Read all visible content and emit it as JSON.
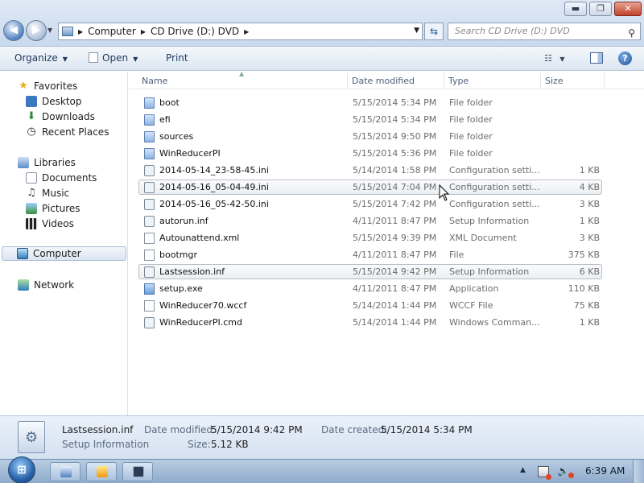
{
  "window": {
    "minimize": "▬",
    "maximize": "❐",
    "close": "✕"
  },
  "address": {
    "crumbs": [
      "Computer",
      "CD Drive (D:) DVD"
    ],
    "search_placeholder": "Search CD Drive (D:) DVD"
  },
  "toolbar": {
    "organize": "Organize",
    "open": "Open",
    "print": "Print",
    "help": "?"
  },
  "nav": {
    "favorites": "Favorites",
    "desktop": "Desktop",
    "downloads": "Downloads",
    "recent_places": "Recent Places",
    "libraries": "Libraries",
    "documents": "Documents",
    "music": "Music",
    "pictures": "Pictures",
    "videos": "Videos",
    "computer": "Computer",
    "network": "Network"
  },
  "columns": {
    "name": "Name",
    "date_modified": "Date modified",
    "type": "Type",
    "size": "Size"
  },
  "files": [
    {
      "name": "boot",
      "date": "5/15/2014 5:34 PM",
      "type": "File folder",
      "size": ""
    },
    {
      "name": "efi",
      "date": "5/15/2014 5:34 PM",
      "type": "File folder",
      "size": ""
    },
    {
      "name": "sources",
      "date": "5/15/2014 9:50 PM",
      "type": "File folder",
      "size": ""
    },
    {
      "name": "WinReducerPI",
      "date": "5/15/2014 5:36 PM",
      "type": "File folder",
      "size": ""
    },
    {
      "name": "2014-05-14_23-58-45.ini",
      "date": "5/14/2014 1:58 PM",
      "type": "Configuration setti...",
      "size": "1 KB"
    },
    {
      "name": "2014-05-16_05-04-49.ini",
      "date": "5/15/2014 7:04 PM",
      "type": "Configuration setti...",
      "size": "4 KB"
    },
    {
      "name": "2014-05-16_05-42-50.ini",
      "date": "5/15/2014 7:42 PM",
      "type": "Configuration setti...",
      "size": "3 KB"
    },
    {
      "name": "autorun.inf",
      "date": "4/11/2011 8:47 PM",
      "type": "Setup Information",
      "size": "1 KB"
    },
    {
      "name": "Autounattend.xml",
      "date": "5/15/2014 9:39 PM",
      "type": "XML Document",
      "size": "3 KB"
    },
    {
      "name": "bootmgr",
      "date": "4/11/2011 8:47 PM",
      "type": "File",
      "size": "375 KB"
    },
    {
      "name": "Lastsession.inf",
      "date": "5/15/2014 9:42 PM",
      "type": "Setup Information",
      "size": "6 KB"
    },
    {
      "name": "setup.exe",
      "date": "4/11/2011 8:47 PM",
      "type": "Application",
      "size": "110 KB"
    },
    {
      "name": "WinReducer70.wccf",
      "date": "5/14/2014 1:44 PM",
      "type": "WCCF File",
      "size": "75 KB"
    },
    {
      "name": "WinReducerPI.cmd",
      "date": "5/14/2014 1:44 PM",
      "type": "Windows Comman...",
      "size": "1 KB"
    }
  ],
  "details": {
    "name": "Lastsession.inf",
    "type": "Setup Information",
    "date_modified_label": "Date modified:",
    "date_modified": "5/15/2014 9:42 PM",
    "size_label": "Size:",
    "size": "5.12 KB",
    "date_created_label": "Date created:",
    "date_created": "5/15/2014 5:34 PM"
  },
  "taskbar": {
    "clock": "6:39 AM"
  }
}
